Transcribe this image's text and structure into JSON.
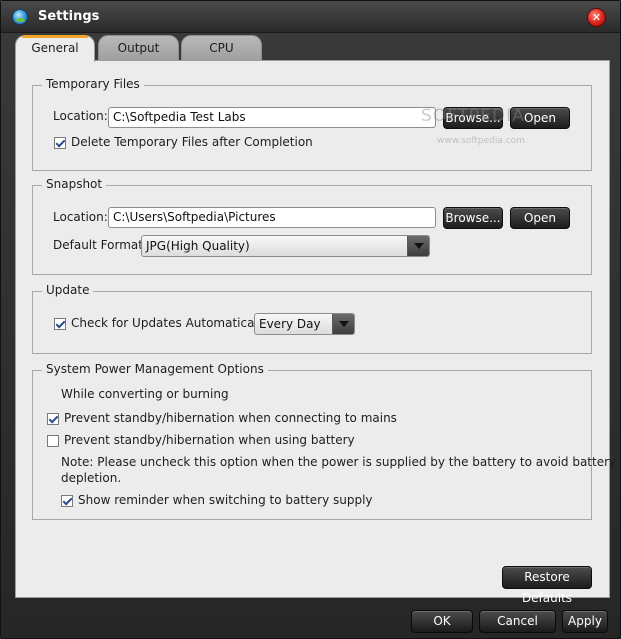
{
  "window": {
    "title": "Settings",
    "app_icon": "app-globe-icon",
    "close_icon": "close-icon",
    "close_glyph": "✕"
  },
  "tabs": [
    {
      "label": "General",
      "active": true
    },
    {
      "label": "Output",
      "active": false
    },
    {
      "label": "CPU",
      "active": false
    }
  ],
  "temporary_files": {
    "legend": "Temporary Files",
    "location_label": "Location:",
    "location_value": "C:\\Softpedia Test Labs",
    "browse_label": "Browse...",
    "open_label": "Open",
    "delete_checkbox_label": "Delete Temporary Files after Completion",
    "delete_checked": true
  },
  "watermark": {
    "brand": "SOFTPEDIA",
    "url": "www.softpedia.com"
  },
  "snapshot": {
    "legend": "Snapshot",
    "location_label": "Location:",
    "location_value": "C:\\Users\\Softpedia\\Pictures",
    "browse_label": "Browse...",
    "open_label": "Open",
    "format_label": "Default Format:",
    "format_value": "JPG(High Quality)"
  },
  "update": {
    "legend": "Update",
    "check_label": "Check for Updates Automatically:",
    "check_checked": true,
    "frequency_value": "Every Day"
  },
  "power": {
    "legend": "System Power Management Options",
    "subheading": "While converting or burning",
    "mains_label": "Prevent standby/hibernation when connecting to mains",
    "mains_checked": true,
    "battery_label": "Prevent standby/hibernation when using battery",
    "battery_checked": false,
    "note_line1": "Note: Please uncheck this option when the power is supplied by the battery to avoid battery",
    "note_line2": "depletion.",
    "reminder_label": "Show reminder when switching to battery supply",
    "reminder_checked": true
  },
  "restore_defaults_label": "Restore Defaults",
  "footer": {
    "ok_label": "OK",
    "cancel_label": "Cancel",
    "apply_label": "Apply"
  },
  "colors": {
    "accent_tab": "#f3a22a",
    "close_button": "#d8231b",
    "panel_bg": "#ececec",
    "button_dark": "#1c1c1c"
  }
}
